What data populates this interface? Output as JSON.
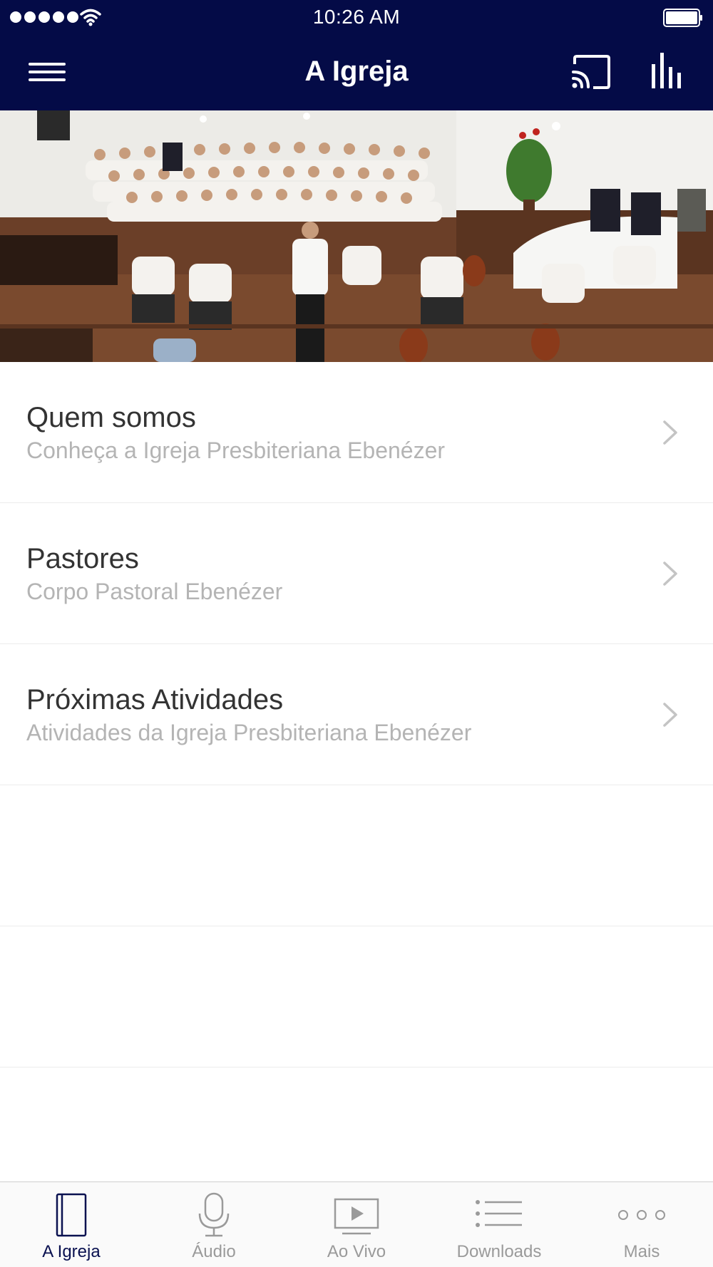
{
  "status_bar": {
    "time": "10:26 AM"
  },
  "nav": {
    "title": "A Igreja"
  },
  "hero": {
    "alt": "Coral e orquestra da igreja"
  },
  "list": {
    "items": [
      {
        "title": "Quem somos",
        "subtitle": "Conheça a Igreja Presbiteriana Ebenézer"
      },
      {
        "title": "Pastores",
        "subtitle": "Corpo Pastoral Ebenézer"
      },
      {
        "title": "Próximas Atividades",
        "subtitle": "Atividades da Igreja Presbiteriana Ebenézer"
      }
    ]
  },
  "tabbar": {
    "tabs": [
      {
        "label": "A Igreja",
        "icon": "book-icon",
        "active": true
      },
      {
        "label": "Áudio",
        "icon": "microphone-icon",
        "active": false
      },
      {
        "label": "Ao Vivo",
        "icon": "video-play-icon",
        "active": false
      },
      {
        "label": "Downloads",
        "icon": "list-icon",
        "active": false
      },
      {
        "label": "Mais",
        "icon": "more-dots-icon",
        "active": false
      }
    ]
  },
  "colors": {
    "nav_background": "#040b47",
    "active_tab": "#0a1150",
    "inactive_tab": "#9a9a9a",
    "subtitle_text": "#b4b4b4"
  }
}
